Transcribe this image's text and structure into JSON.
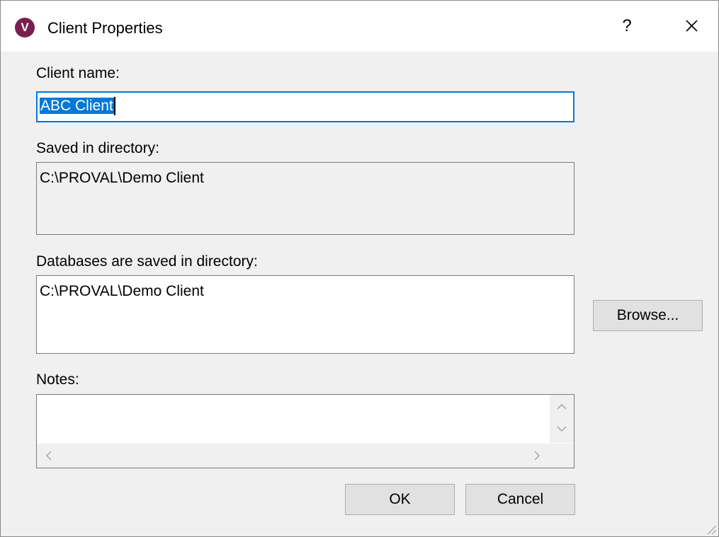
{
  "window": {
    "title": "Client Properties",
    "app_icon_letter": "V",
    "help_label": "?",
    "accent_color": "#7a1f4d"
  },
  "form": {
    "client_name_label": "Client name:",
    "client_name_value": "ABC Client",
    "saved_dir_label": "Saved in directory:",
    "saved_dir_value": "C:\\PROVAL\\Demo Client",
    "db_dir_label": "Databases are saved in directory:",
    "db_dir_value": "C:\\PROVAL\\Demo Client",
    "notes_label": "Notes:",
    "notes_value": ""
  },
  "buttons": {
    "browse_label": "Browse...",
    "ok_label": "OK",
    "cancel_label": "Cancel"
  }
}
